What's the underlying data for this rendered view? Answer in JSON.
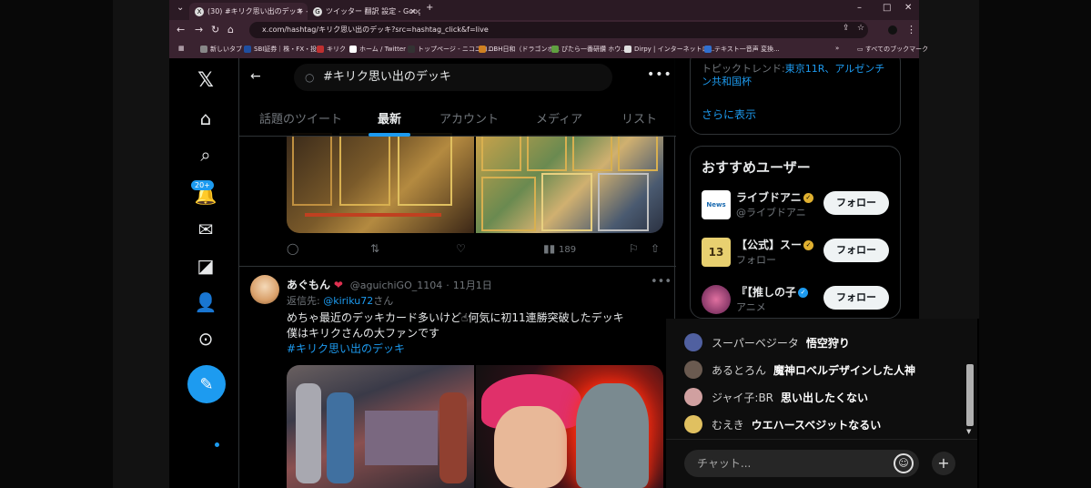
{
  "browser": {
    "tabs": [
      {
        "label": "(30) #キリク思い出のデッキ - 検索",
        "icon": "x-logo-icon"
      },
      {
        "label": "ツイッター 翻訳 設定 - Google 検",
        "icon": "google-icon"
      }
    ],
    "new_tab": "+",
    "url": "x.com/hashtag/キリク思い出のデッキ?src=hashtag_click&f=live",
    "bookmarks": [
      {
        "label": "新しいタブ",
        "color": "#888888"
      },
      {
        "label": "SBI証券｜株・FX・投...",
        "color": "#1f4fa0"
      },
      {
        "label": "キリク",
        "color": "#c03030"
      },
      {
        "label": "ホーム / Twitter",
        "color": "#ffffff"
      },
      {
        "label": "トップページ - ニコニコ...",
        "color": "#333333"
      },
      {
        "label": "DBH日和（ドラゴンボ...",
        "color": "#d08020"
      },
      {
        "label": "ぴたら一番研鑽 ホウ...",
        "color": "#60a040"
      },
      {
        "label": "Dirpy | インターネットロ...",
        "color": "#e0e0e0"
      },
      {
        "label": "テキスト一音声 変換...",
        "color": "#3070d0"
      }
    ],
    "bookmarks_more": "»",
    "all_bookmarks": "すべてのブックマーク"
  },
  "nav": {
    "notification_badge": "20+"
  },
  "search": {
    "query": "#キリク思い出のデッキ",
    "tabs": [
      "話題のツイート",
      "最新",
      "アカウント",
      "メディア",
      "リスト"
    ],
    "active_tab": "最新"
  },
  "tweet1": {
    "views": "189"
  },
  "tweet2": {
    "name": "あぐもん",
    "handle": "@aguichiGO_1104",
    "date": "11月1日",
    "reply_prefix": "返信先:",
    "reply_to": "@kiriku72",
    "reply_suffix": "さん",
    "line1": "めちゃ最近のデッキカード多いけど",
    "line1b": "何気に初11連勝突破したデッキ",
    "line2": "僕はキリクさんの大ファンです",
    "hashtag": "#キリク思い出のデッキ"
  },
  "trends": {
    "prefix": "トピックトレンド:",
    "items": "東京11R、アルゼンチン共和国杯",
    "show_more": "さらに表示"
  },
  "recommend": {
    "title": "おすすめユーザー",
    "follow_label": "フォロー",
    "users": [
      {
        "name": "ライブドアニ",
        "handle": "@ライブドアニ",
        "avatar_text": "News",
        "avatar_color": "#ffffff",
        "verified_color": "#e0b030"
      },
      {
        "name": "【公式】スー",
        "handle": "フォロー",
        "avatar_text": "13",
        "avatar_color": "#e8d070",
        "verified_color": "#e0b030"
      },
      {
        "name": "『【推しの子",
        "handle": "アニメ",
        "avatar_text": "",
        "avatar_color": "#c04080",
        "verified_color": "#1d9bf0"
      }
    ]
  },
  "chat": {
    "messages": [
      {
        "user": "スーパーベジータ",
        "msg": "悟空狩り",
        "color": "#5060a0"
      },
      {
        "user": "あるとろん",
        "msg": "魔神ロベルデザインした人神",
        "color": "#6a5a50"
      },
      {
        "user": "ジャイ子:BR",
        "msg": "思い出したくない",
        "color": "#d0a0a0"
      },
      {
        "user": "むえき",
        "msg": "ウエハースベジットなるい",
        "color": "#e0c060"
      }
    ],
    "placeholder": "チャット..."
  }
}
